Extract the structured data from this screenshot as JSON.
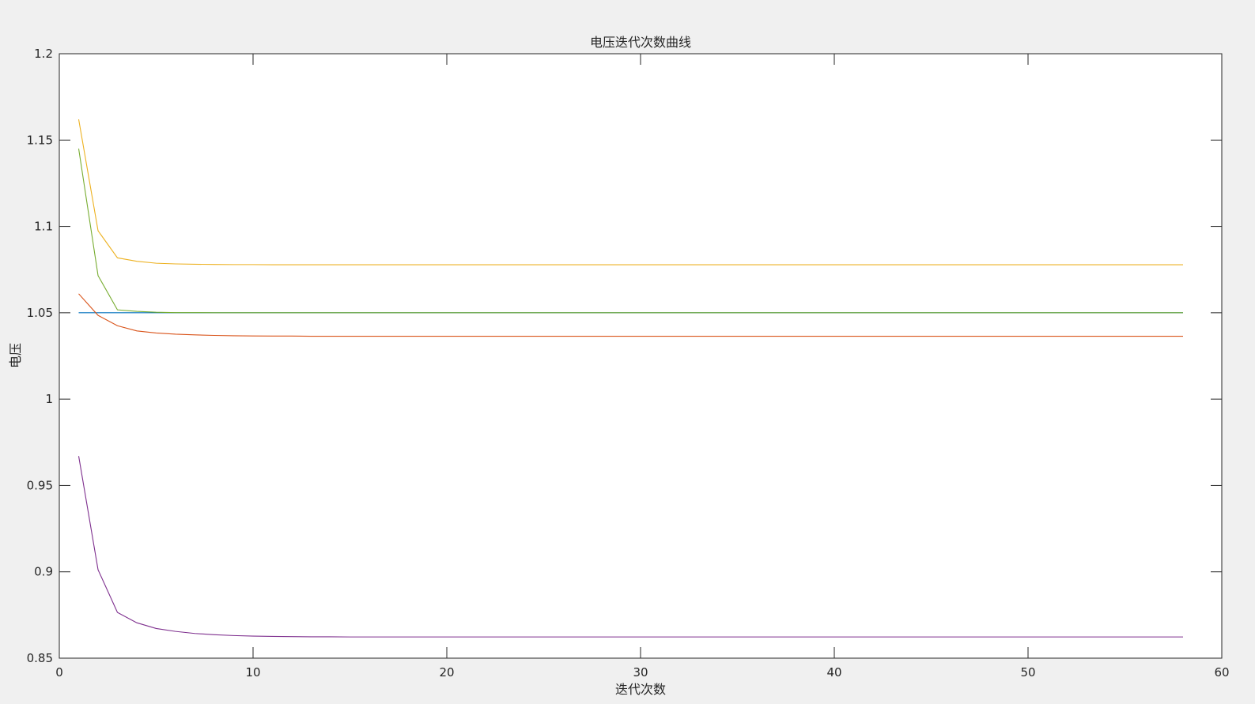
{
  "chart_data": {
    "type": "line",
    "title": "电压迭代次数曲线",
    "xlabel": "迭代次数",
    "ylabel": "电压",
    "xlim": [
      0,
      60
    ],
    "ylim": [
      0.85,
      1.2
    ],
    "xticks": [
      0,
      10,
      20,
      30,
      40,
      50,
      60
    ],
    "yticks": [
      0.85,
      0.9,
      0.95,
      1,
      1.05,
      1.1,
      1.15,
      1.2
    ],
    "xtick_labels": [
      "0",
      "10",
      "20",
      "30",
      "40",
      "50",
      "60"
    ],
    "ytick_labels": [
      "0.85",
      "0.9",
      "0.95",
      "1",
      "1.05",
      "1.1",
      "1.15",
      "1.2"
    ],
    "grid": false,
    "box": true,
    "x": [
      1,
      2,
      3,
      4,
      5,
      6,
      7,
      8,
      9,
      10,
      11,
      12,
      13,
      14,
      15,
      16,
      17,
      18,
      19,
      20,
      21,
      22,
      23,
      24,
      25,
      26,
      27,
      28,
      29,
      30,
      31,
      32,
      33,
      34,
      35,
      36,
      37,
      38,
      39,
      40,
      41,
      42,
      43,
      44,
      45,
      46,
      47,
      48,
      49,
      50,
      51,
      52,
      53,
      54,
      55,
      56,
      57,
      58
    ],
    "series": [
      {
        "color": "#0072BD",
        "values": [
          1.05,
          1.05,
          1.05,
          1.05,
          1.05,
          1.05,
          1.05,
          1.05,
          1.05,
          1.05,
          1.05,
          1.05,
          1.05,
          1.05,
          1.05,
          1.05,
          1.05,
          1.05,
          1.05,
          1.05,
          1.05,
          1.05,
          1.05,
          1.05,
          1.05,
          1.05,
          1.05,
          1.05,
          1.05,
          1.05,
          1.05,
          1.05,
          1.05,
          1.05,
          1.05,
          1.05,
          1.05,
          1.05,
          1.05,
          1.05,
          1.05,
          1.05,
          1.05,
          1.05,
          1.05,
          1.05,
          1.05,
          1.05,
          1.05,
          1.05,
          1.05,
          1.05,
          1.05,
          1.05,
          1.05,
          1.05,
          1.05,
          1.05
        ]
      },
      {
        "color": "#D95319",
        "values": [
          1.061,
          1.0485,
          1.0425,
          1.0395,
          1.0383,
          1.0376,
          1.0372,
          1.0369,
          1.0367,
          1.0366,
          1.0365,
          1.0365,
          1.0364,
          1.0364,
          1.0364,
          1.0364,
          1.0364,
          1.0364,
          1.0364,
          1.0364,
          1.0364,
          1.0364,
          1.0364,
          1.0364,
          1.0364,
          1.0364,
          1.0364,
          1.0364,
          1.0364,
          1.0364,
          1.0364,
          1.0364,
          1.0364,
          1.0364,
          1.0364,
          1.0364,
          1.0364,
          1.0364,
          1.0364,
          1.0364,
          1.0364,
          1.0364,
          1.0364,
          1.0364,
          1.0364,
          1.0364,
          1.0364,
          1.0364,
          1.0364,
          1.0364,
          1.0364,
          1.0364,
          1.0364,
          1.0364,
          1.0364,
          1.0364,
          1.0364,
          1.0364
        ]
      },
      {
        "color": "#EDB120",
        "values": [
          1.162,
          1.0975,
          1.0818,
          1.0798,
          1.0787,
          1.0783,
          1.0781,
          1.078,
          1.0779,
          1.0779,
          1.0778,
          1.0778,
          1.0778,
          1.0778,
          1.0778,
          1.0778,
          1.0778,
          1.0778,
          1.0778,
          1.0778,
          1.0778,
          1.0778,
          1.0778,
          1.0778,
          1.0778,
          1.0778,
          1.0778,
          1.0778,
          1.0778,
          1.0778,
          1.0778,
          1.0778,
          1.0778,
          1.0778,
          1.0778,
          1.0778,
          1.0778,
          1.0778,
          1.0778,
          1.0778,
          1.0778,
          1.0778,
          1.0778,
          1.0778,
          1.0778,
          1.0778,
          1.0778,
          1.0778,
          1.0778,
          1.0778,
          1.0778,
          1.0778,
          1.0778,
          1.0778,
          1.0778,
          1.0778,
          1.0778,
          1.0778
        ]
      },
      {
        "color": "#7E2F8E",
        "values": [
          0.967,
          0.9012,
          0.8765,
          0.8705,
          0.8672,
          0.8655,
          0.8643,
          0.8636,
          0.8631,
          0.8628,
          0.8626,
          0.8625,
          0.8624,
          0.8624,
          0.8623,
          0.8623,
          0.8623,
          0.8623,
          0.8623,
          0.8623,
          0.8623,
          0.8623,
          0.8623,
          0.8623,
          0.8623,
          0.8623,
          0.8623,
          0.8623,
          0.8623,
          0.8623,
          0.8623,
          0.8623,
          0.8623,
          0.8623,
          0.8623,
          0.8623,
          0.8623,
          0.8623,
          0.8623,
          0.8623,
          0.8623,
          0.8623,
          0.8623,
          0.8623,
          0.8623,
          0.8623,
          0.8623,
          0.8623,
          0.8623,
          0.8623,
          0.8623,
          0.8623,
          0.8623,
          0.8623,
          0.8623,
          0.8623,
          0.8623,
          0.8623
        ]
      },
      {
        "color": "#77AC30",
        "values": [
          1.145,
          1.0715,
          1.0517,
          1.0508,
          1.0503,
          1.0501,
          1.0501,
          1.05,
          1.05,
          1.05,
          1.05,
          1.05,
          1.05,
          1.05,
          1.05,
          1.05,
          1.05,
          1.05,
          1.05,
          1.05,
          1.05,
          1.05,
          1.05,
          1.05,
          1.05,
          1.05,
          1.05,
          1.05,
          1.05,
          1.05,
          1.05,
          1.05,
          1.05,
          1.05,
          1.05,
          1.05,
          1.05,
          1.05,
          1.05,
          1.05,
          1.05,
          1.05,
          1.05,
          1.05,
          1.05,
          1.05,
          1.05,
          1.05,
          1.05,
          1.05,
          1.05,
          1.05,
          1.05,
          1.05,
          1.05,
          1.05,
          1.05,
          1.05
        ]
      }
    ]
  }
}
